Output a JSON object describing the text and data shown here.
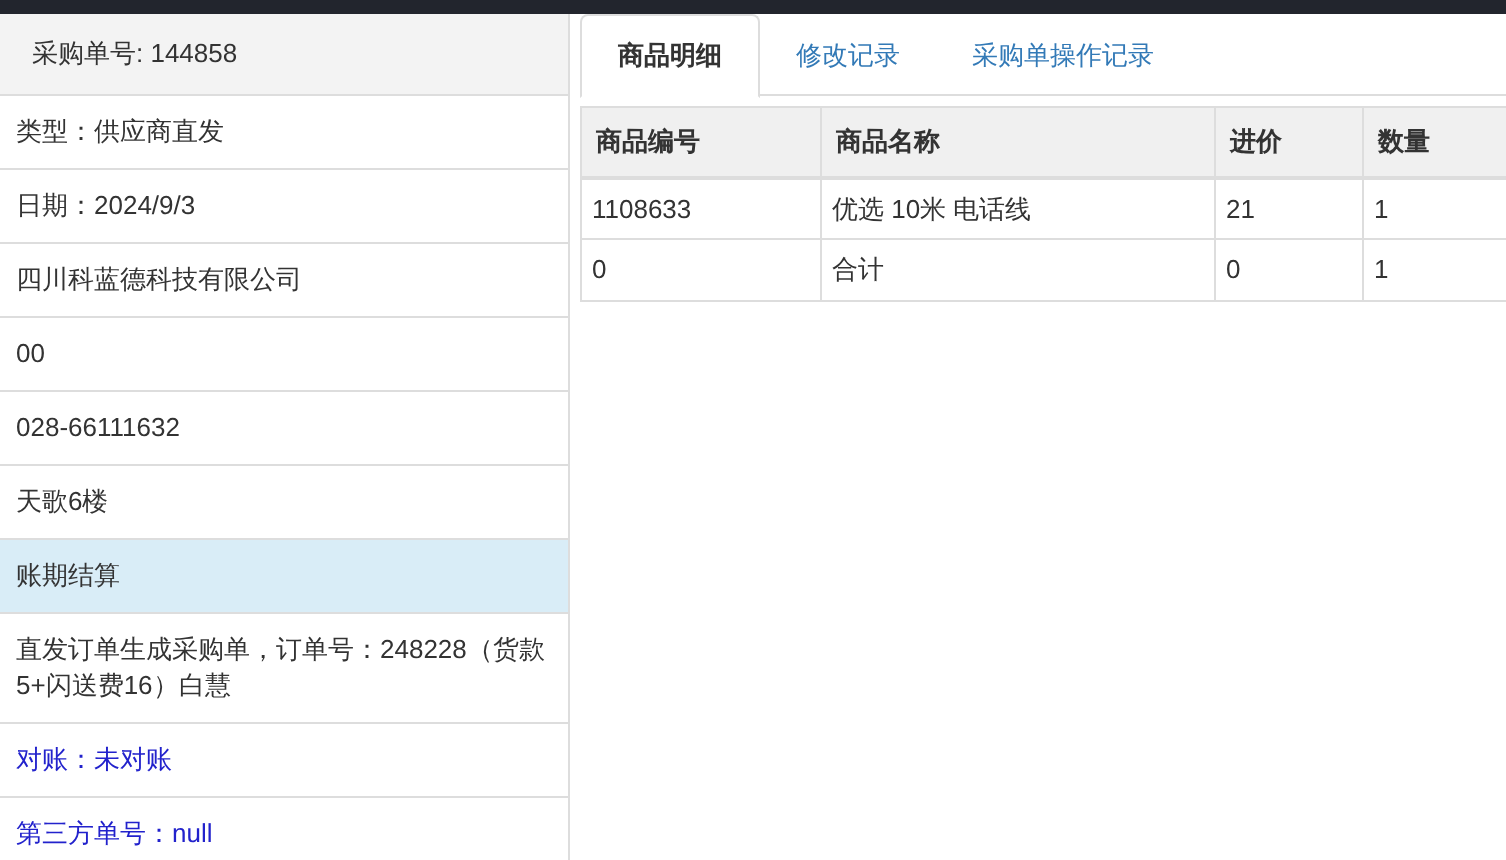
{
  "header": {
    "title": "采购单号: 144858"
  },
  "info_rows": [
    {
      "text": "类型：供应商直发",
      "kind": "plain"
    },
    {
      "text": "日期：2024/9/3",
      "kind": "plain"
    },
    {
      "text": "四川科蓝德科技有限公司",
      "kind": "plain"
    },
    {
      "text": "00",
      "kind": "plain"
    },
    {
      "text": "028-66111632",
      "kind": "plain"
    },
    {
      "text": "天歌6楼",
      "kind": "plain"
    },
    {
      "text": "账期结算",
      "kind": "highlight"
    },
    {
      "text": "直发订单生成采购单，订单号：248228（货款5+闪送费16）白慧",
      "kind": "plain"
    },
    {
      "text": "对账：未对账",
      "kind": "link"
    },
    {
      "text": "第三方单号：null",
      "kind": "link"
    }
  ],
  "tabs": [
    {
      "label": "商品明细",
      "selected": true
    },
    {
      "label": "修改记录",
      "selected": false
    },
    {
      "label": "采购单操作记录",
      "selected": false
    }
  ],
  "table": {
    "columns": [
      "商品编号",
      "商品名称",
      "进价",
      "数量"
    ],
    "rows": [
      [
        "1108633",
        "优选 10米 电话线",
        "21",
        "1"
      ],
      [
        "0",
        "合计",
        "0",
        "1"
      ]
    ]
  }
}
